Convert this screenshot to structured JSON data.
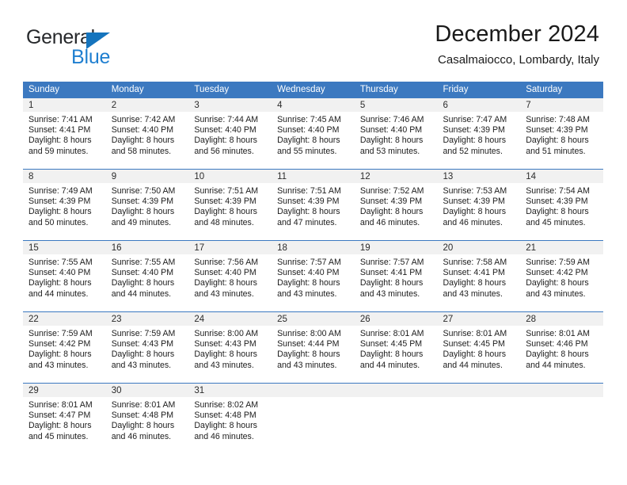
{
  "brand": {
    "name_part1": "General",
    "name_part2": "Blue",
    "logo_icon": "triangle-logo-icon"
  },
  "header": {
    "title": "December 2024",
    "subtitle": "Casalmaiocco, Lombardy, Italy"
  },
  "colors": {
    "header_blue": "#3c79c0",
    "brand_blue": "#1f7fd0",
    "daynum_band": "#f1f1f1",
    "text": "#1c1c1c"
  },
  "calendar": {
    "weekday_headers": [
      "Sunday",
      "Monday",
      "Tuesday",
      "Wednesday",
      "Thursday",
      "Friday",
      "Saturday"
    ],
    "weeks": [
      [
        {
          "day": "1",
          "sunrise": "Sunrise: 7:41 AM",
          "sunset": "Sunset: 4:41 PM",
          "daylight_l1": "Daylight: 8 hours",
          "daylight_l2": "and 59 minutes."
        },
        {
          "day": "2",
          "sunrise": "Sunrise: 7:42 AM",
          "sunset": "Sunset: 4:40 PM",
          "daylight_l1": "Daylight: 8 hours",
          "daylight_l2": "and 58 minutes."
        },
        {
          "day": "3",
          "sunrise": "Sunrise: 7:44 AM",
          "sunset": "Sunset: 4:40 PM",
          "daylight_l1": "Daylight: 8 hours",
          "daylight_l2": "and 56 minutes."
        },
        {
          "day": "4",
          "sunrise": "Sunrise: 7:45 AM",
          "sunset": "Sunset: 4:40 PM",
          "daylight_l1": "Daylight: 8 hours",
          "daylight_l2": "and 55 minutes."
        },
        {
          "day": "5",
          "sunrise": "Sunrise: 7:46 AM",
          "sunset": "Sunset: 4:40 PM",
          "daylight_l1": "Daylight: 8 hours",
          "daylight_l2": "and 53 minutes."
        },
        {
          "day": "6",
          "sunrise": "Sunrise: 7:47 AM",
          "sunset": "Sunset: 4:39 PM",
          "daylight_l1": "Daylight: 8 hours",
          "daylight_l2": "and 52 minutes."
        },
        {
          "day": "7",
          "sunrise": "Sunrise: 7:48 AM",
          "sunset": "Sunset: 4:39 PM",
          "daylight_l1": "Daylight: 8 hours",
          "daylight_l2": "and 51 minutes."
        }
      ],
      [
        {
          "day": "8",
          "sunrise": "Sunrise: 7:49 AM",
          "sunset": "Sunset: 4:39 PM",
          "daylight_l1": "Daylight: 8 hours",
          "daylight_l2": "and 50 minutes."
        },
        {
          "day": "9",
          "sunrise": "Sunrise: 7:50 AM",
          "sunset": "Sunset: 4:39 PM",
          "daylight_l1": "Daylight: 8 hours",
          "daylight_l2": "and 49 minutes."
        },
        {
          "day": "10",
          "sunrise": "Sunrise: 7:51 AM",
          "sunset": "Sunset: 4:39 PM",
          "daylight_l1": "Daylight: 8 hours",
          "daylight_l2": "and 48 minutes."
        },
        {
          "day": "11",
          "sunrise": "Sunrise: 7:51 AM",
          "sunset": "Sunset: 4:39 PM",
          "daylight_l1": "Daylight: 8 hours",
          "daylight_l2": "and 47 minutes."
        },
        {
          "day": "12",
          "sunrise": "Sunrise: 7:52 AM",
          "sunset": "Sunset: 4:39 PM",
          "daylight_l1": "Daylight: 8 hours",
          "daylight_l2": "and 46 minutes."
        },
        {
          "day": "13",
          "sunrise": "Sunrise: 7:53 AM",
          "sunset": "Sunset: 4:39 PM",
          "daylight_l1": "Daylight: 8 hours",
          "daylight_l2": "and 46 minutes."
        },
        {
          "day": "14",
          "sunrise": "Sunrise: 7:54 AM",
          "sunset": "Sunset: 4:39 PM",
          "daylight_l1": "Daylight: 8 hours",
          "daylight_l2": "and 45 minutes."
        }
      ],
      [
        {
          "day": "15",
          "sunrise": "Sunrise: 7:55 AM",
          "sunset": "Sunset: 4:40 PM",
          "daylight_l1": "Daylight: 8 hours",
          "daylight_l2": "and 44 minutes."
        },
        {
          "day": "16",
          "sunrise": "Sunrise: 7:55 AM",
          "sunset": "Sunset: 4:40 PM",
          "daylight_l1": "Daylight: 8 hours",
          "daylight_l2": "and 44 minutes."
        },
        {
          "day": "17",
          "sunrise": "Sunrise: 7:56 AM",
          "sunset": "Sunset: 4:40 PM",
          "daylight_l1": "Daylight: 8 hours",
          "daylight_l2": "and 43 minutes."
        },
        {
          "day": "18",
          "sunrise": "Sunrise: 7:57 AM",
          "sunset": "Sunset: 4:40 PM",
          "daylight_l1": "Daylight: 8 hours",
          "daylight_l2": "and 43 minutes."
        },
        {
          "day": "19",
          "sunrise": "Sunrise: 7:57 AM",
          "sunset": "Sunset: 4:41 PM",
          "daylight_l1": "Daylight: 8 hours",
          "daylight_l2": "and 43 minutes."
        },
        {
          "day": "20",
          "sunrise": "Sunrise: 7:58 AM",
          "sunset": "Sunset: 4:41 PM",
          "daylight_l1": "Daylight: 8 hours",
          "daylight_l2": "and 43 minutes."
        },
        {
          "day": "21",
          "sunrise": "Sunrise: 7:59 AM",
          "sunset": "Sunset: 4:42 PM",
          "daylight_l1": "Daylight: 8 hours",
          "daylight_l2": "and 43 minutes."
        }
      ],
      [
        {
          "day": "22",
          "sunrise": "Sunrise: 7:59 AM",
          "sunset": "Sunset: 4:42 PM",
          "daylight_l1": "Daylight: 8 hours",
          "daylight_l2": "and 43 minutes."
        },
        {
          "day": "23",
          "sunrise": "Sunrise: 7:59 AM",
          "sunset": "Sunset: 4:43 PM",
          "daylight_l1": "Daylight: 8 hours",
          "daylight_l2": "and 43 minutes."
        },
        {
          "day": "24",
          "sunrise": "Sunrise: 8:00 AM",
          "sunset": "Sunset: 4:43 PM",
          "daylight_l1": "Daylight: 8 hours",
          "daylight_l2": "and 43 minutes."
        },
        {
          "day": "25",
          "sunrise": "Sunrise: 8:00 AM",
          "sunset": "Sunset: 4:44 PM",
          "daylight_l1": "Daylight: 8 hours",
          "daylight_l2": "and 43 minutes."
        },
        {
          "day": "26",
          "sunrise": "Sunrise: 8:01 AM",
          "sunset": "Sunset: 4:45 PM",
          "daylight_l1": "Daylight: 8 hours",
          "daylight_l2": "and 44 minutes."
        },
        {
          "day": "27",
          "sunrise": "Sunrise: 8:01 AM",
          "sunset": "Sunset: 4:45 PM",
          "daylight_l1": "Daylight: 8 hours",
          "daylight_l2": "and 44 minutes."
        },
        {
          "day": "28",
          "sunrise": "Sunrise: 8:01 AM",
          "sunset": "Sunset: 4:46 PM",
          "daylight_l1": "Daylight: 8 hours",
          "daylight_l2": "and 44 minutes."
        }
      ],
      [
        {
          "day": "29",
          "sunrise": "Sunrise: 8:01 AM",
          "sunset": "Sunset: 4:47 PM",
          "daylight_l1": "Daylight: 8 hours",
          "daylight_l2": "and 45 minutes."
        },
        {
          "day": "30",
          "sunrise": "Sunrise: 8:01 AM",
          "sunset": "Sunset: 4:48 PM",
          "daylight_l1": "Daylight: 8 hours",
          "daylight_l2": "and 46 minutes."
        },
        {
          "day": "31",
          "sunrise": "Sunrise: 8:02 AM",
          "sunset": "Sunset: 4:48 PM",
          "daylight_l1": "Daylight: 8 hours",
          "daylight_l2": "and 46 minutes."
        },
        {
          "day": "",
          "sunrise": "",
          "sunset": "",
          "daylight_l1": "",
          "daylight_l2": ""
        },
        {
          "day": "",
          "sunrise": "",
          "sunset": "",
          "daylight_l1": "",
          "daylight_l2": ""
        },
        {
          "day": "",
          "sunrise": "",
          "sunset": "",
          "daylight_l1": "",
          "daylight_l2": ""
        },
        {
          "day": "",
          "sunrise": "",
          "sunset": "",
          "daylight_l1": "",
          "daylight_l2": ""
        }
      ]
    ]
  }
}
